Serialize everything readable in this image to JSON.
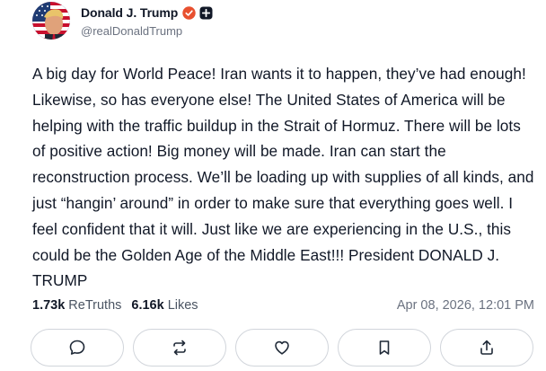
{
  "author": {
    "display_name": "Donald J. Trump",
    "handle": "@realDonaldTrump",
    "verified": true,
    "icons": {
      "avatar": "avatar-image",
      "verified": "verified-badge-icon",
      "plus": "plus-badge-icon"
    }
  },
  "post": {
    "text": "A big day for World Peace! Iran wants it to happen, they’ve had enough! Likewise, so has everyone else! The United States of America will be helping with the traffic buildup in the Strait of Hormuz. There will be lots of positive action! Big money will be made. Iran can start the reconstruction process. We’ll be loading up with supplies of all kinds, and just “hangin’ around” in order to make sure that everything goes well. I feel confident that it will. Just like we are experiencing in the U.S., this could be the Golden Age of the Middle East!!! President DONALD J. TRUMP"
  },
  "stats": {
    "retruths_count": "1.73k",
    "retruths_label": "ReTruths",
    "likes_count": "6.16k",
    "likes_label": "Likes",
    "timestamp": "Apr 08, 2026, 12:01 PM"
  },
  "actions": [
    {
      "name": "reply",
      "icon": "comment-icon"
    },
    {
      "name": "retruth",
      "icon": "repost-icon"
    },
    {
      "name": "like",
      "icon": "heart-icon"
    },
    {
      "name": "bookmark",
      "icon": "bookmark-icon"
    },
    {
      "name": "share",
      "icon": "share-icon"
    }
  ],
  "colors": {
    "text": "#111827",
    "muted": "#6b7280",
    "border": "#d1d5db",
    "verified": "#e8502f"
  }
}
